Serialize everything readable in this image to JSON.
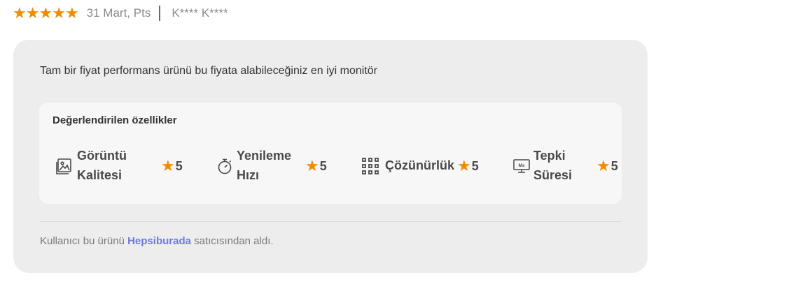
{
  "review": {
    "rating": 5,
    "rating_max": 5,
    "date": "31 Mart, Pts",
    "author": "K**** K****",
    "comment": "Tam bir fiyat performans ürünü bu fiyata alabileceğiniz en iyi monitör",
    "accent_color": "#f28b00"
  },
  "features": {
    "title": "Değerlendirilen özellikler",
    "items": [
      {
        "label_line1": "Görüntü",
        "label_line2": "Kalitesi",
        "rating": "5",
        "icon": "image-icon"
      },
      {
        "label_line1": "Yenileme",
        "label_line2": "Hızı",
        "rating": "5",
        "icon": "stopwatch-icon"
      },
      {
        "label_line1": "Çözünürlük",
        "label_line2": "",
        "rating": "5",
        "icon": "grid-icon"
      },
      {
        "label_line1": "Tepki",
        "label_line2": "Süresi",
        "rating": "5",
        "icon": "monitor-ms-icon"
      }
    ]
  },
  "footer": {
    "prefix": "Kullanıcı bu ürünü",
    "seller": "Hepsiburada",
    "suffix": "satıcısından aldı.",
    "seller_color": "#6b78e6"
  }
}
